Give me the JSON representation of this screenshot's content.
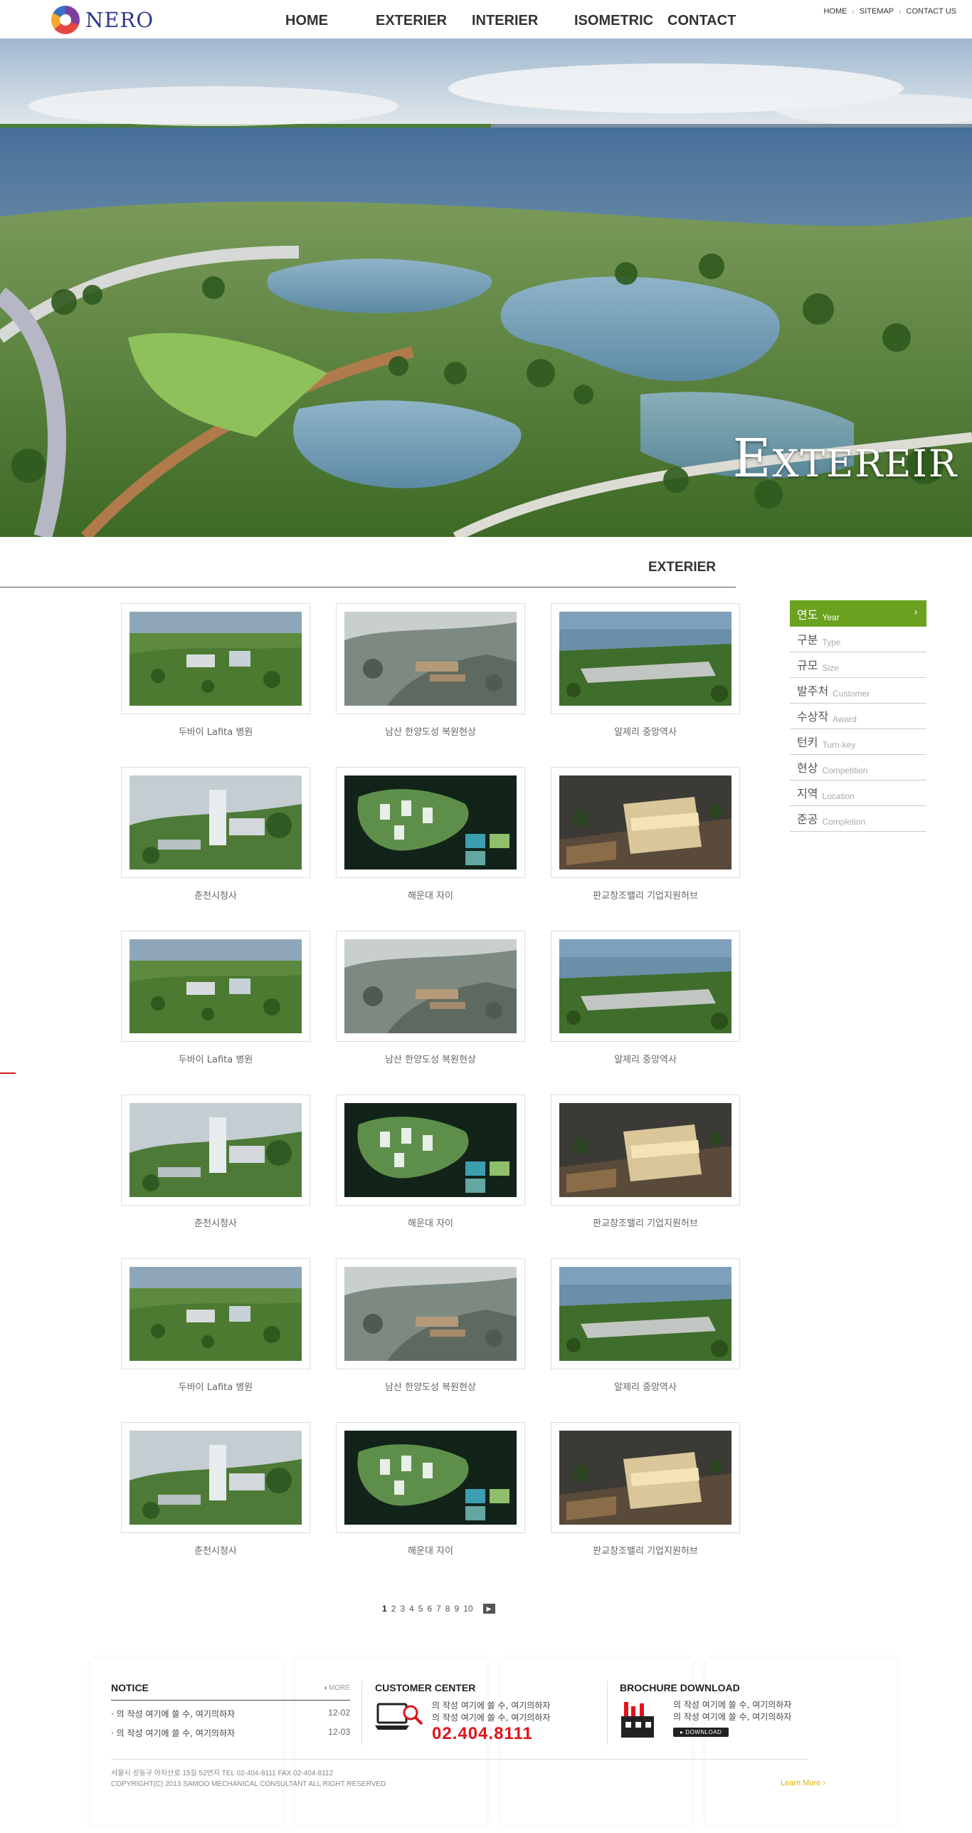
{
  "header": {
    "logo_text": "NERO",
    "nav": [
      "HOME",
      "EXTERIER",
      "INTERIER",
      "ISOMETRIC",
      "CONTACT"
    ],
    "util": [
      "HOME",
      "SITEMAP",
      "CONTACT US"
    ]
  },
  "hero": {
    "title_first": "E",
    "title_rest": "XTEREIR"
  },
  "section": {
    "title": "EXTERIER"
  },
  "side_menu": [
    {
      "ko": "연도",
      "en": "Year",
      "active": true
    },
    {
      "ko": "구분",
      "en": "Type"
    },
    {
      "ko": "규모",
      "en": "Size"
    },
    {
      "ko": "발주처",
      "en": "Customer"
    },
    {
      "ko": "수상작",
      "en": "Award"
    },
    {
      "ko": "턴키",
      "en": "Turn-key"
    },
    {
      "ko": "현상",
      "en": "Competition"
    },
    {
      "ko": "지역",
      "en": "Location"
    },
    {
      "ko": "준공",
      "en": "Completion"
    }
  ],
  "projects": [
    {
      "caption": "두바이 Lafita 병원",
      "style": "aerial-green"
    },
    {
      "caption": "남산 한양도성 복원현상",
      "style": "hill-grey"
    },
    {
      "caption": "알제리 중앙역사",
      "style": "plain-wide"
    },
    {
      "caption": "춘천시청사",
      "style": "tower"
    },
    {
      "caption": "해운대 자이",
      "style": "plan-dark"
    },
    {
      "caption": "판교창조밸리 기업지원허브",
      "style": "night-building"
    },
    {
      "caption": "두바이 Lafita 병원",
      "style": "aerial-green"
    },
    {
      "caption": "남산 한양도성 복원현상",
      "style": "hill-grey"
    },
    {
      "caption": "알제리 중앙역사",
      "style": "plain-wide"
    },
    {
      "caption": "춘천시청사",
      "style": "tower"
    },
    {
      "caption": "해운대 자이",
      "style": "plan-dark"
    },
    {
      "caption": "판교창조밸리 기업지원허브",
      "style": "night-building"
    },
    {
      "caption": "두바이 Lafita 병원",
      "style": "aerial-green"
    },
    {
      "caption": "남산 한양도성 복원현상",
      "style": "hill-grey"
    },
    {
      "caption": "알제리 중앙역사",
      "style": "plain-wide"
    },
    {
      "caption": "춘천시청사",
      "style": "tower"
    },
    {
      "caption": "해운대 자이",
      "style": "plan-dark"
    },
    {
      "caption": "판교창조밸리 기업지원허브",
      "style": "night-building"
    }
  ],
  "pagination": {
    "pages": [
      "1",
      "2",
      "3",
      "4",
      "5",
      "6",
      "7",
      "8",
      "9",
      "10"
    ],
    "current": "1",
    "next_symbol": "▶"
  },
  "footer": {
    "notice": {
      "title": "NOTICE",
      "more": "MORE",
      "items": [
        {
          "text": "의 작성 여기에 쓸 수, 여기의하자",
          "date": "12-02"
        },
        {
          "text": "의 작성 여기에 쓸 수, 여기의하자",
          "date": "12-03"
        }
      ]
    },
    "customer_center": {
      "title": "CUSTOMER CENTER",
      "lines": [
        "의 작성 여기에 쓸 수, 여기의하자",
        "의 작성 여기에 쓸 수, 여기의하자"
      ],
      "phone": "02.404.8111"
    },
    "brochure": {
      "title": "BROCHURE DOWNLOAD",
      "lines": [
        "의 작성 여기에 쓸 수, 여기의하자",
        "의 작성 여기에 쓸 수, 여기의하자"
      ],
      "button": "DOWNLOAD"
    },
    "address": [
      "서울시 성동구 아차산로 15길 52번지    TEL 02-404-8111    FAX 02-404-8112",
      "COPYRIGHT(C) 2013 SAMOO MECHANICAL CONSULTANT  ALL RIGHT RESERVED"
    ],
    "learn_more": "Learn More"
  },
  "colors": {
    "accent_green": "#6aa220",
    "phone_red": "#e0131b",
    "logo_blue": "#2f3a8c"
  }
}
